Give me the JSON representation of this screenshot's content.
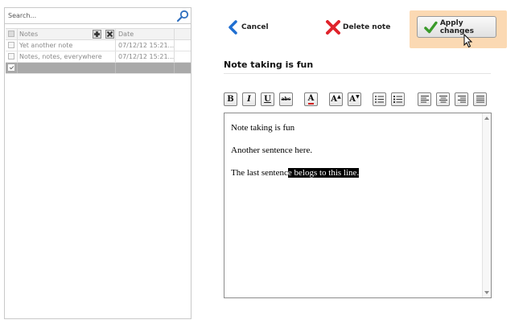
{
  "sidebar": {
    "search": {
      "placeholder": "Search...",
      "value": ""
    },
    "grid": {
      "headers": {
        "notes": "Notes",
        "date": "Date"
      },
      "rows": [
        {
          "title": "Yet another note",
          "date": "07/12/12 15:21...",
          "checked": false
        },
        {
          "title": "Notes, notes, everywhere",
          "date": "07/12/12 15:21...",
          "checked": false
        },
        {
          "title": "",
          "date": "",
          "checked": true
        }
      ]
    }
  },
  "toolbar": {
    "cancel_label": "Cancel",
    "delete_label": "Delete note",
    "apply_label": "Apply changes"
  },
  "note": {
    "title": "Note taking is fun",
    "paragraphs": {
      "p1": "Note taking is fun",
      "p2": "Another sentence here.",
      "p3_plain": "The last sentenc",
      "p3_selected": "e belogs to this line."
    }
  },
  "format_bar": {
    "bold": "B",
    "italic": "I",
    "underline": "U",
    "strike": "abc",
    "font_color": "A",
    "font_grow": "A",
    "font_shrink": "A"
  },
  "colors": {
    "accent_highlight": "#fbd9b3",
    "selected_row": "#a9a9a9",
    "cancel_arrow": "#1f6fd1",
    "delete_x": "#e0232b",
    "apply_check": "#3a9a2a"
  }
}
